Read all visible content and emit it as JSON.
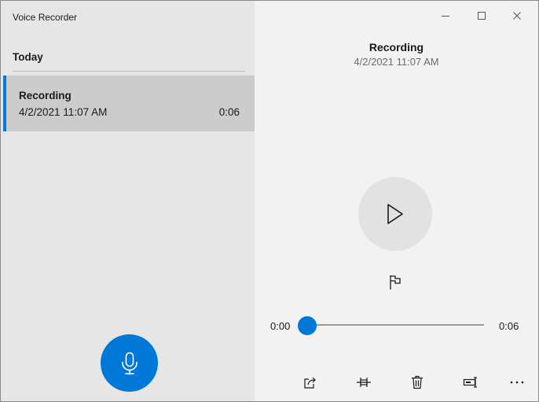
{
  "app": {
    "title": "Voice Recorder"
  },
  "window_controls": {
    "minimize_icon": "minimize-icon",
    "maximize_icon": "maximize-icon",
    "close_icon": "close-icon"
  },
  "list": {
    "group_label": "Today",
    "items": [
      {
        "name": "Recording",
        "date": "4/2/2021 11:07 AM",
        "duration": "0:06",
        "selected": true
      }
    ]
  },
  "detail": {
    "title": "Recording",
    "date": "4/2/2021 11:07 AM",
    "playback": {
      "current_time": "0:00",
      "total_time": "0:06",
      "position": 0
    }
  },
  "toolbar": {
    "icons": [
      "share-icon",
      "trim-icon",
      "delete-icon",
      "rename-icon",
      "more-icon"
    ]
  },
  "colors": {
    "accent": "#0078d7",
    "left_pane_bg": "#e6e6e6",
    "selected_item_bg": "#cccccc",
    "right_pane_bg": "#f2f2f2"
  }
}
